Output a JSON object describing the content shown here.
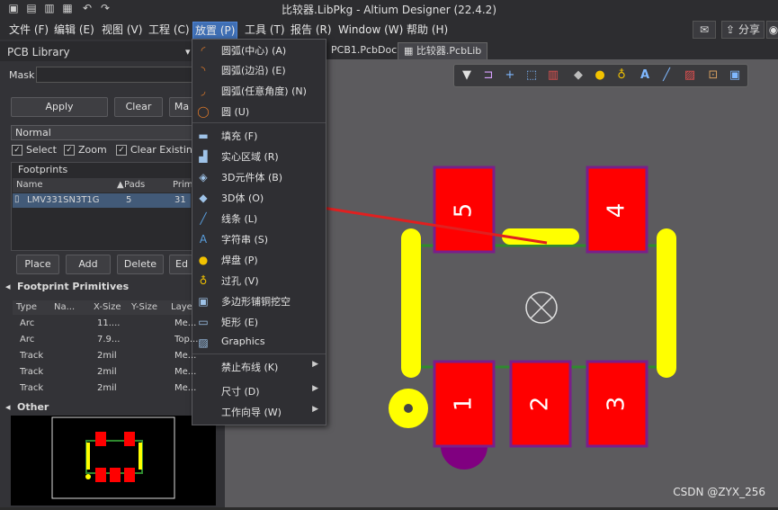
{
  "window": {
    "title": "比较器.LibPkg - Altium Designer (22.4.2)",
    "quick_access": [
      "save-icon",
      "save-all-icon",
      "open-icon",
      "open-project-icon",
      "undo-icon",
      "redo-icon"
    ]
  },
  "menubar": {
    "items": [
      "文件 (F)",
      "编辑 (E)",
      "视图 (V)",
      "工程 (C)",
      "放置 (P)",
      "工具 (T)",
      "报告 (R)",
      "Window (W)",
      "帮助 (H)"
    ],
    "active": "放置 (P)",
    "share_label": "分享"
  },
  "panel": {
    "title": "PCB Library",
    "mask_label": "Mask",
    "mask_value": "",
    "apply_label": "Apply",
    "clear_label": "Clear",
    "magnify_label": "Ma",
    "mode_value": "Normal",
    "select_label": "Select",
    "zoom_label": "Zoom",
    "clear_existing_label": "Clear Existing",
    "footprints_label": "Footprints",
    "fp_columns": [
      "Name",
      "Pads",
      "Primi"
    ],
    "fp_rows": [
      {
        "name": "LMV331SN3T1G",
        "pads": "5",
        "primi": "31"
      }
    ],
    "place_label": "Place",
    "add_label": "Add",
    "delete_label": "Delete",
    "edit_label": "Ed",
    "prims_label": "Footprint Primitives",
    "pr_columns": [
      "Type",
      "Na...",
      "X-Size",
      "Y-Size",
      "Layer"
    ],
    "pr_rows": [
      {
        "type": "Arc",
        "name": "",
        "x": "11....",
        "y": "",
        "layer": "Me..."
      },
      {
        "type": "Arc",
        "name": "",
        "x": "7.9...",
        "y": "",
        "layer": "Top..."
      },
      {
        "type": "Track",
        "name": "",
        "x": "2mil",
        "y": "",
        "layer": "Me..."
      },
      {
        "type": "Track",
        "name": "",
        "x": "2mil",
        "y": "",
        "layer": "Me..."
      },
      {
        "type": "Track",
        "name": "",
        "x": "2mil",
        "y": "",
        "layer": "Me..."
      }
    ],
    "other_label": "Other"
  },
  "tabs": [
    {
      "label": "PCB1.PcbDoc",
      "active": false
    },
    {
      "label": "比较器.PcbLib",
      "active": true
    }
  ],
  "dropdown": {
    "items": [
      {
        "label": "圆弧(中心) (A)",
        "icon": "arc-center-icon",
        "color": "#e07a2a"
      },
      {
        "label": "圆弧(边沿) (E)",
        "icon": "arc-edge-icon",
        "color": "#e07a2a"
      },
      {
        "label": "圆弧(任意角度) (N)",
        "icon": "arc-any-icon",
        "color": "#e07a2a"
      },
      {
        "label": "圆 (U)",
        "icon": "circle-icon",
        "color": "#e07a2a"
      },
      {
        "label": "填充 (F)",
        "icon": "fill-icon",
        "color": "#9fc3e8"
      },
      {
        "label": "实心区域 (R)",
        "icon": "solid-region-icon",
        "color": "#9fc3e8"
      },
      {
        "label": "3D元件体 (B)",
        "icon": "3d-component-icon",
        "color": "#9fc3e8"
      },
      {
        "label": "3D体 (O)",
        "icon": "3d-body-icon",
        "color": "#9fc3e8"
      },
      {
        "label": "线条 (L)",
        "icon": "line-icon",
        "color": "#5aa0e0"
      },
      {
        "label": "字符串 (S)",
        "icon": "string-icon",
        "color": "#5aa0e0"
      },
      {
        "label": "焊盘 (P)",
        "icon": "pad-icon",
        "color": "#f2c200"
      },
      {
        "label": "过孔 (V)",
        "icon": "via-icon",
        "color": "#f2c200"
      },
      {
        "label": "多边形铺铜挖空",
        "icon": "polygon-cutout-icon",
        "color": "#9fc3e8"
      },
      {
        "label": "矩形 (E)",
        "icon": "rectangle-icon",
        "color": "#9fc3e8"
      },
      {
        "label": "Graphics",
        "icon": "graphics-icon",
        "color": "#9fc3e8"
      },
      {
        "label": "禁止布线 (K)",
        "icon": "",
        "color": "",
        "submenu": true
      },
      {
        "label": "尺寸 (D)",
        "icon": "",
        "color": "",
        "submenu": true
      },
      {
        "label": "工作向导 (W)",
        "icon": "",
        "color": "",
        "submenu": true
      }
    ]
  },
  "canvas": {
    "pad_labels": [
      "5",
      "4",
      "1",
      "2",
      "3"
    ],
    "colors": {
      "pad": "#ff0000",
      "pad_border": "#7a1f8a",
      "silk": "#ffff00",
      "outline": "#2f8a2f",
      "pin1": "#800080",
      "arrow": "#e02020"
    }
  },
  "watermark": "CSDN @ZYX_256"
}
